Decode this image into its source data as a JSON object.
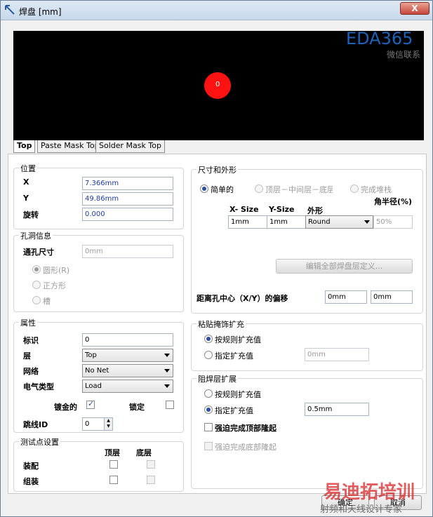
{
  "window": {
    "title": "焊盘 [mm]",
    "close_label": "X"
  },
  "preview": {
    "pad_label": "0"
  },
  "tabs": [
    "Top",
    "Paste Mask Top",
    "Solder Mask Top"
  ],
  "location": {
    "title": "位置",
    "x_label": "X",
    "x_value": "7.366mm",
    "y_label": "Y",
    "y_value": "49.86mm",
    "rotation_label": "旋转",
    "rotation_value": "0.000"
  },
  "hole": {
    "title": "孔洞信息",
    "size_label": "通孔尺寸",
    "size_value": "0mm",
    "shapes": [
      "圆形(R)",
      "正方形",
      "槽"
    ]
  },
  "properties": {
    "title": "属性",
    "designator_label": "标识",
    "designator_value": "0",
    "layer_label": "层",
    "layer_value": "Top",
    "net_label": "网络",
    "net_value": "No Net",
    "electrical_label": "电气类型",
    "electrical_value": "Load",
    "plated_label": "镀金的",
    "locked_label": "锁定",
    "jumper_label": "跳线ID",
    "jumper_value": "0"
  },
  "testpoint": {
    "title": "测试点设置",
    "top_label": "顶层",
    "bottom_label": "底层",
    "assembly_label": "装配",
    "fabrication_label": "组装"
  },
  "size_shape": {
    "title": "尺寸和外形",
    "radio_simple": "简单的",
    "radio_top_mid_bottom": "顶层－中间层－底层",
    "radio_full_stack": "完成堆栈",
    "corner_radius_label": "角半径(%)",
    "xsize_label": "X- Size",
    "ysize_label": "Y-Size",
    "shape_label": "外形",
    "xsize_value": "1mm",
    "ysize_value": "1mm",
    "shape_value": "Round",
    "corner_value": "50%",
    "edit_button": "编辑全部焊盘层定义...",
    "offset_label": "距离孔中心（X/Y）的偏移",
    "offset_x_value": "0mm",
    "offset_y_value": "0mm"
  },
  "paste_mask": {
    "title": "粘贴掩饰扩充",
    "by_rule": "按规则扩充值",
    "specify": "指定扩充值",
    "specify_value": "0mm"
  },
  "solder_mask": {
    "title": "阻焊层扩展",
    "by_rule": "按规则扩充值",
    "specify": "指定扩充值",
    "specify_value": "0.5mm",
    "force_top": "强迫完成顶部隆起",
    "force_bottom": "强迫完成底部隆起"
  },
  "footer": {
    "ok_label": "确定",
    "cancel_label": "取消"
  },
  "watermarks": {
    "top_brand": "EDA365",
    "top_sub": "微信联系",
    "bottom_brand": "易迪拓培训",
    "bottom_sub": "射频和天线设计专家"
  },
  "colors": {
    "pad": "#ff1212",
    "accent": "#2b4ea3",
    "watermark_blue": "#1e63b8",
    "watermark_red": "#d9282a"
  }
}
